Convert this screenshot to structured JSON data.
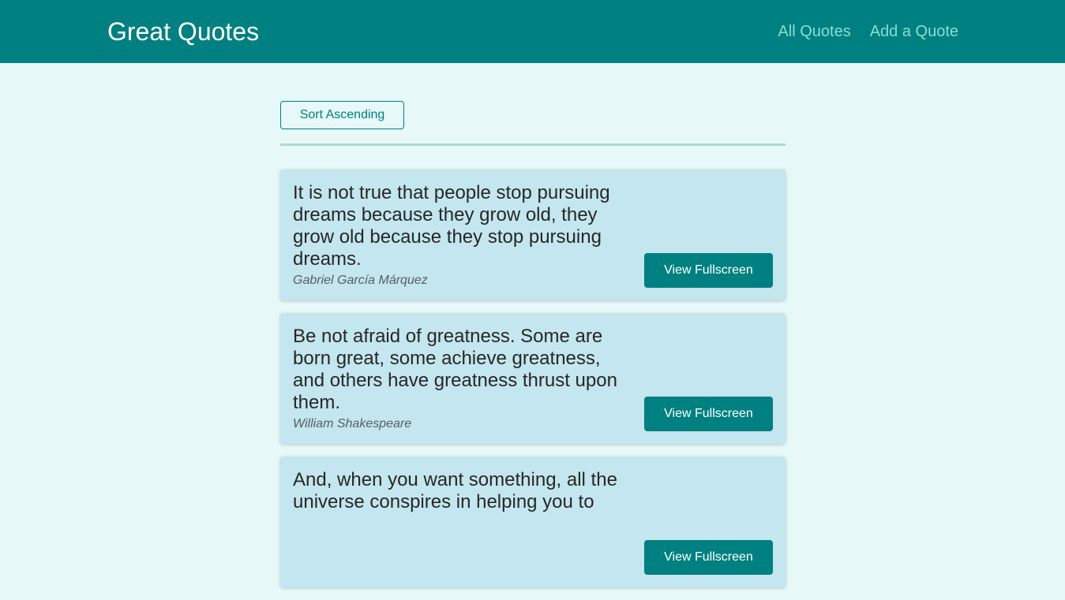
{
  "header": {
    "logo": "Great Quotes",
    "nav": [
      {
        "label": "All Quotes"
      },
      {
        "label": "Add a Quote"
      }
    ]
  },
  "sorting": {
    "button_label": "Sort Ascending"
  },
  "quotes": [
    {
      "text": "It is not true that people stop pursuing dreams because they grow old, they grow old because they stop pursuing dreams.",
      "author": "Gabriel García Márquez",
      "button_label": "View Fullscreen"
    },
    {
      "text": "Be not afraid of greatness. Some are born great, some achieve greatness, and others have greatness thrust upon them.",
      "author": "William Shakespeare",
      "button_label": "View Fullscreen"
    },
    {
      "text": "And, when you want something, all the universe conspires in helping you to",
      "author": "",
      "button_label": "View Fullscreen"
    }
  ],
  "colors": {
    "header_bg": "#008080",
    "page_bg": "#e6f8f8",
    "card_bg": "#c3e6ef",
    "nav_link": "#88dfd3",
    "button_bg": "#008080"
  }
}
